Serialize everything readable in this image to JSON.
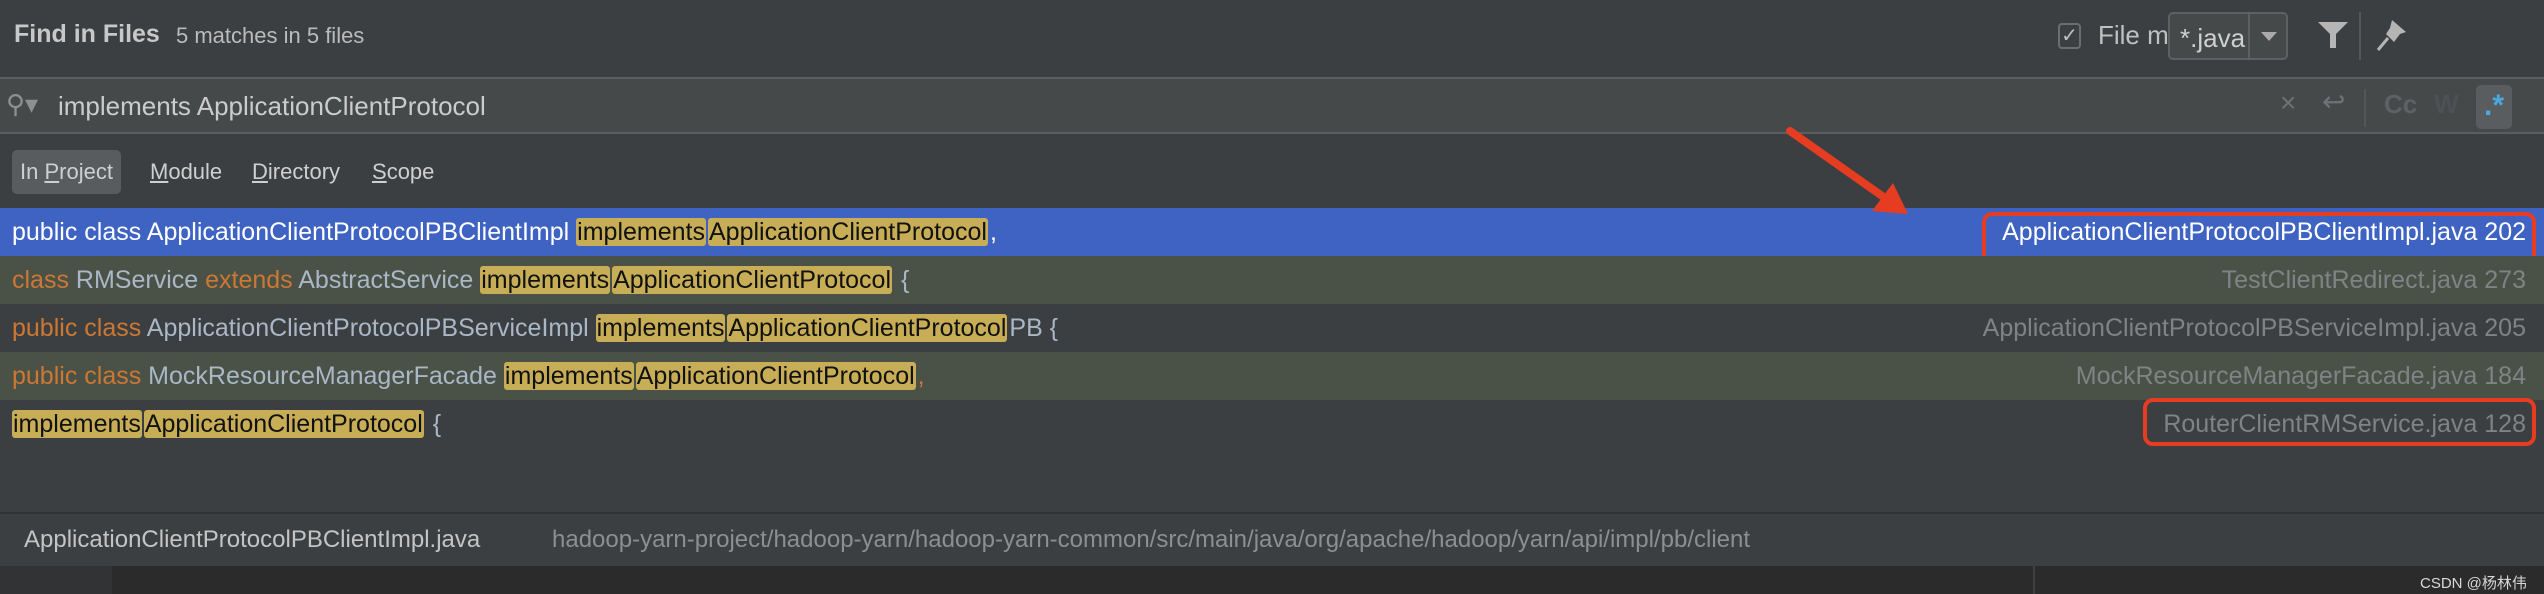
{
  "header": {
    "title": "Find in Files",
    "summary": "5 matches in 5 files",
    "file_mask_checked": true,
    "file_mask_label": "File mask:",
    "file_mask_value": "*.java",
    "filter_icon": "filter-icon",
    "pin_icon": "pin-icon"
  },
  "search": {
    "query": "implements ApplicationClientProtocol",
    "search_icon": "search-icon",
    "clear_icon": "close-icon",
    "newline_icon": "newline-icon",
    "match_case_label": "Cc",
    "words_label": "W",
    "regex_label": ".*",
    "regex_active": true
  },
  "scopes": [
    {
      "pre": "In ",
      "u": "P",
      "post": "roject",
      "active": true
    },
    {
      "pre": "",
      "u": "M",
      "post": "odule",
      "active": false
    },
    {
      "pre": "",
      "u": "D",
      "post": "irectory",
      "active": false
    },
    {
      "pre": "",
      "u": "S",
      "post": "cope",
      "active": false
    }
  ],
  "results": [
    {
      "selected": true,
      "segments": [
        {
          "t": "public class ApplicationClientProtocolPBClientImpl ",
          "k": "tx"
        },
        {
          "t": "implements",
          "k": "hl"
        },
        {
          "t": "ApplicationClientProtocol",
          "k": "hl"
        },
        {
          "t": ",",
          "k": "tx"
        }
      ],
      "file": "ApplicationClientProtocolPBClientImpl.java 202",
      "annotated": true
    },
    {
      "selected": false,
      "segments": [
        {
          "t": "class ",
          "k": "kw"
        },
        {
          "t": "RMService ",
          "k": "tx"
        },
        {
          "t": "extends ",
          "k": "kw"
        },
        {
          "t": "AbstractService ",
          "k": "tx"
        },
        {
          "t": "implements",
          "k": "hl"
        },
        {
          "t": "ApplicationClientProtocol",
          "k": "hl"
        },
        {
          "t": " {",
          "k": "tx"
        }
      ],
      "file": "TestClientRedirect.java 273",
      "annotated": false
    },
    {
      "selected": false,
      "segments": [
        {
          "t": "public class ",
          "k": "kw"
        },
        {
          "t": "ApplicationClientProtocolPBServiceImpl ",
          "k": "tx"
        },
        {
          "t": "implements",
          "k": "hl"
        },
        {
          "t": "ApplicationClientProtocol",
          "k": "hl"
        },
        {
          "t": "PB {",
          "k": "tx"
        }
      ],
      "file": "ApplicationClientProtocolPBServiceImpl.java 205",
      "annotated": false
    },
    {
      "selected": false,
      "segments": [
        {
          "t": "public class ",
          "k": "kw"
        },
        {
          "t": "MockResourceManagerFacade ",
          "k": "tx"
        },
        {
          "t": "implements",
          "k": "hl"
        },
        {
          "t": "ApplicationClientProtocol",
          "k": "hl"
        },
        {
          "t": ",",
          "k": "kw"
        }
      ],
      "file": "MockResourceManagerFacade.java 184",
      "annotated": false
    },
    {
      "selected": false,
      "segments": [
        {
          "t": "implements",
          "k": "hl"
        },
        {
          "t": "ApplicationClientProtocol",
          "k": "hl"
        },
        {
          "t": " {",
          "k": "tx"
        }
      ],
      "file": "RouterClientRMService.java 128",
      "annotated": true
    }
  ],
  "preview": {
    "file": "ApplicationClientProtocolPBClientImpl.java",
    "path": "hadoop-yarn-project/hadoop-yarn/hadoop-yarn-common/src/main/java/org/apache/hadoop/yarn/api/impl/pb/client"
  },
  "watermark": "CSDN @杨林伟",
  "colors": {
    "selection": "#3e63c3",
    "match_highlight": "#c7ad55",
    "keyword": "#cc7832",
    "annotation": "#e63c22"
  }
}
